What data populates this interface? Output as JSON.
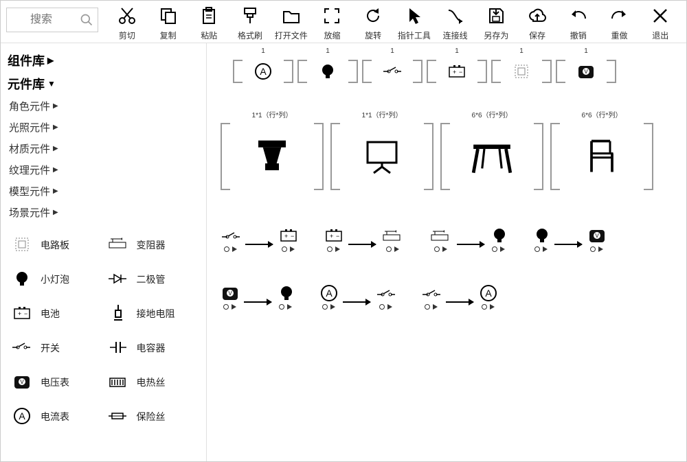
{
  "search": {
    "placeholder": "搜索"
  },
  "toolbar": [
    {
      "id": "cut",
      "label": "剪切"
    },
    {
      "id": "copy",
      "label": "复制"
    },
    {
      "id": "paste",
      "label": "粘贴"
    },
    {
      "id": "format",
      "label": "格式刷"
    },
    {
      "id": "open",
      "label": "打开文件"
    },
    {
      "id": "zoom",
      "label": "放缩"
    },
    {
      "id": "rotate",
      "label": "旋转"
    },
    {
      "id": "pointer",
      "label": "指针工具"
    },
    {
      "id": "connector",
      "label": "连接线"
    },
    {
      "id": "saveas",
      "label": "另存为"
    },
    {
      "id": "save",
      "label": "保存"
    },
    {
      "id": "undo",
      "label": "撤销"
    },
    {
      "id": "redo",
      "label": "重做"
    },
    {
      "id": "exit",
      "label": "退出"
    }
  ],
  "sidebar": {
    "componentLib": "组件库",
    "partLib": "元件库",
    "categories": [
      "角色元件",
      "光照元件",
      "材质元件",
      "纹理元件",
      "模型元件",
      "场景元件"
    ],
    "palette": [
      {
        "a": "电路板",
        "b": "变阻器"
      },
      {
        "a": "小灯泡",
        "b": "二极管"
      },
      {
        "a": "电池",
        "b": "接地电阻"
      },
      {
        "a": "开关",
        "b": "电容器"
      },
      {
        "a": "电压表",
        "b": "电热丝"
      },
      {
        "a": "电流表",
        "b": "保险丝"
      }
    ]
  },
  "canvas": {
    "row1_labels": [
      "1",
      "1",
      "1",
      "1",
      "1",
      "1"
    ],
    "row2_labels": [
      "1*1（行*列）",
      "1*1（行*列）",
      "6*6（行*列）",
      "6*6（行*列）"
    ]
  }
}
